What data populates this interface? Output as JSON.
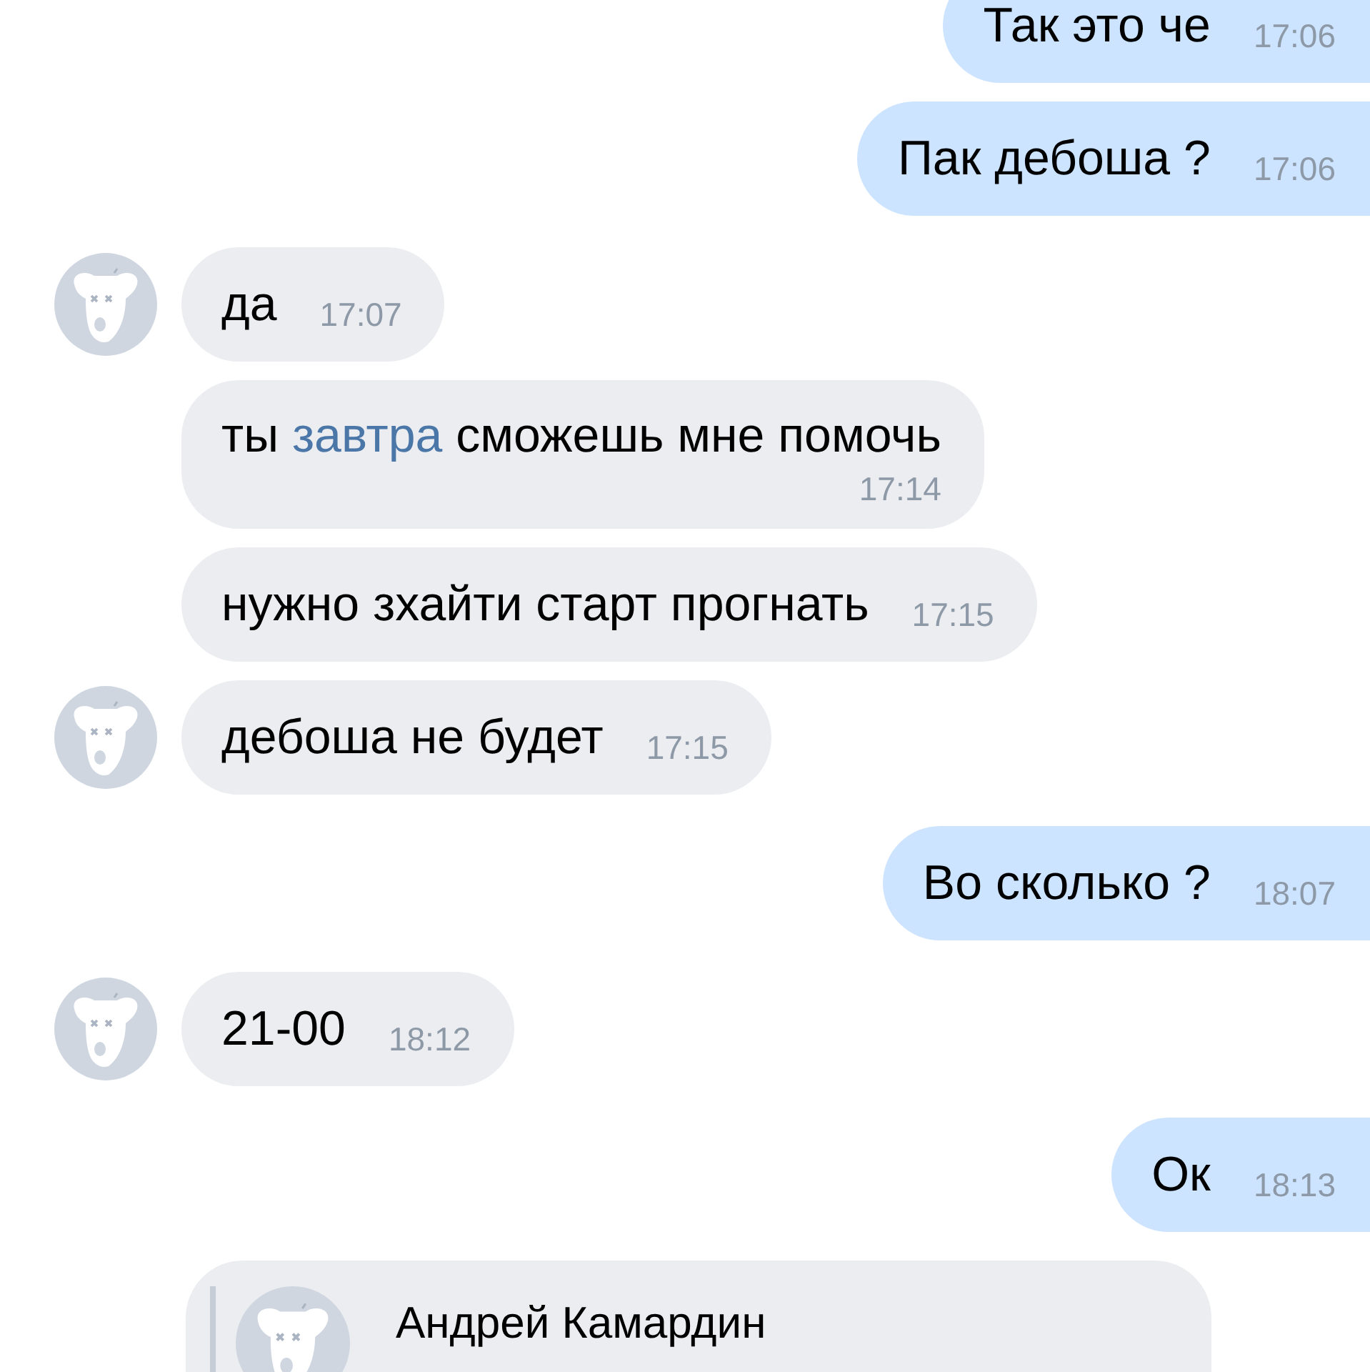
{
  "messages": [
    {
      "kind": "outgoing",
      "parts": [
        {
          "kind": "plain",
          "text": "Так это че"
        }
      ],
      "time": "17:06"
    },
    {
      "kind": "outgoing",
      "parts": [
        {
          "kind": "plain",
          "text": "Пак дебоша ?"
        }
      ],
      "time": "17:06"
    },
    {
      "kind": "incoming",
      "avatar": true,
      "parts": [
        {
          "kind": "plain",
          "text": "да"
        }
      ],
      "time": "17:07"
    },
    {
      "kind": "incoming",
      "avatar": false,
      "wrapped": true,
      "parts": [
        {
          "kind": "plain",
          "text": "ты "
        },
        {
          "kind": "link",
          "text": "завтра"
        },
        {
          "kind": "plain",
          "text": " сможешь мне помочь"
        }
      ],
      "time": "17:14"
    },
    {
      "kind": "incoming",
      "avatar": false,
      "parts": [
        {
          "kind": "plain",
          "text": "нужно зхайти старт прогнать"
        }
      ],
      "time": "17:15"
    },
    {
      "kind": "incoming",
      "avatar": true,
      "parts": [
        {
          "kind": "plain",
          "text": "дебоша не будет"
        }
      ],
      "time": "17:15"
    },
    {
      "kind": "outgoing",
      "parts": [
        {
          "kind": "plain",
          "text": "Во сколько ?"
        }
      ],
      "time": "18:07"
    },
    {
      "kind": "incoming",
      "avatar": true,
      "parts": [
        {
          "kind": "plain",
          "text": "21-00"
        }
      ],
      "time": "18:12"
    },
    {
      "kind": "outgoing",
      "parts": [
        {
          "kind": "plain",
          "text": "Ок"
        }
      ],
      "time": "18:13"
    }
  ],
  "forwarded": {
    "author": "Андрей Камардин"
  }
}
